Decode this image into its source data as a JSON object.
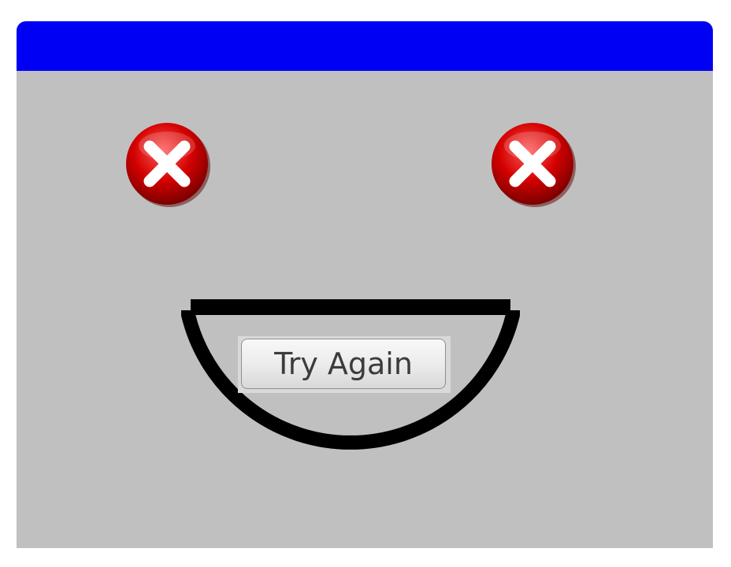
{
  "window": {
    "titlebar_color": "#0000f5",
    "background_color": "#c0c0c0"
  },
  "face": {
    "left_eye_icon": "error-x-icon",
    "right_eye_icon": "error-x-icon",
    "eye_color": "#d40000",
    "mouth_color": "#000000"
  },
  "retry_button": {
    "label": "Try Again"
  }
}
